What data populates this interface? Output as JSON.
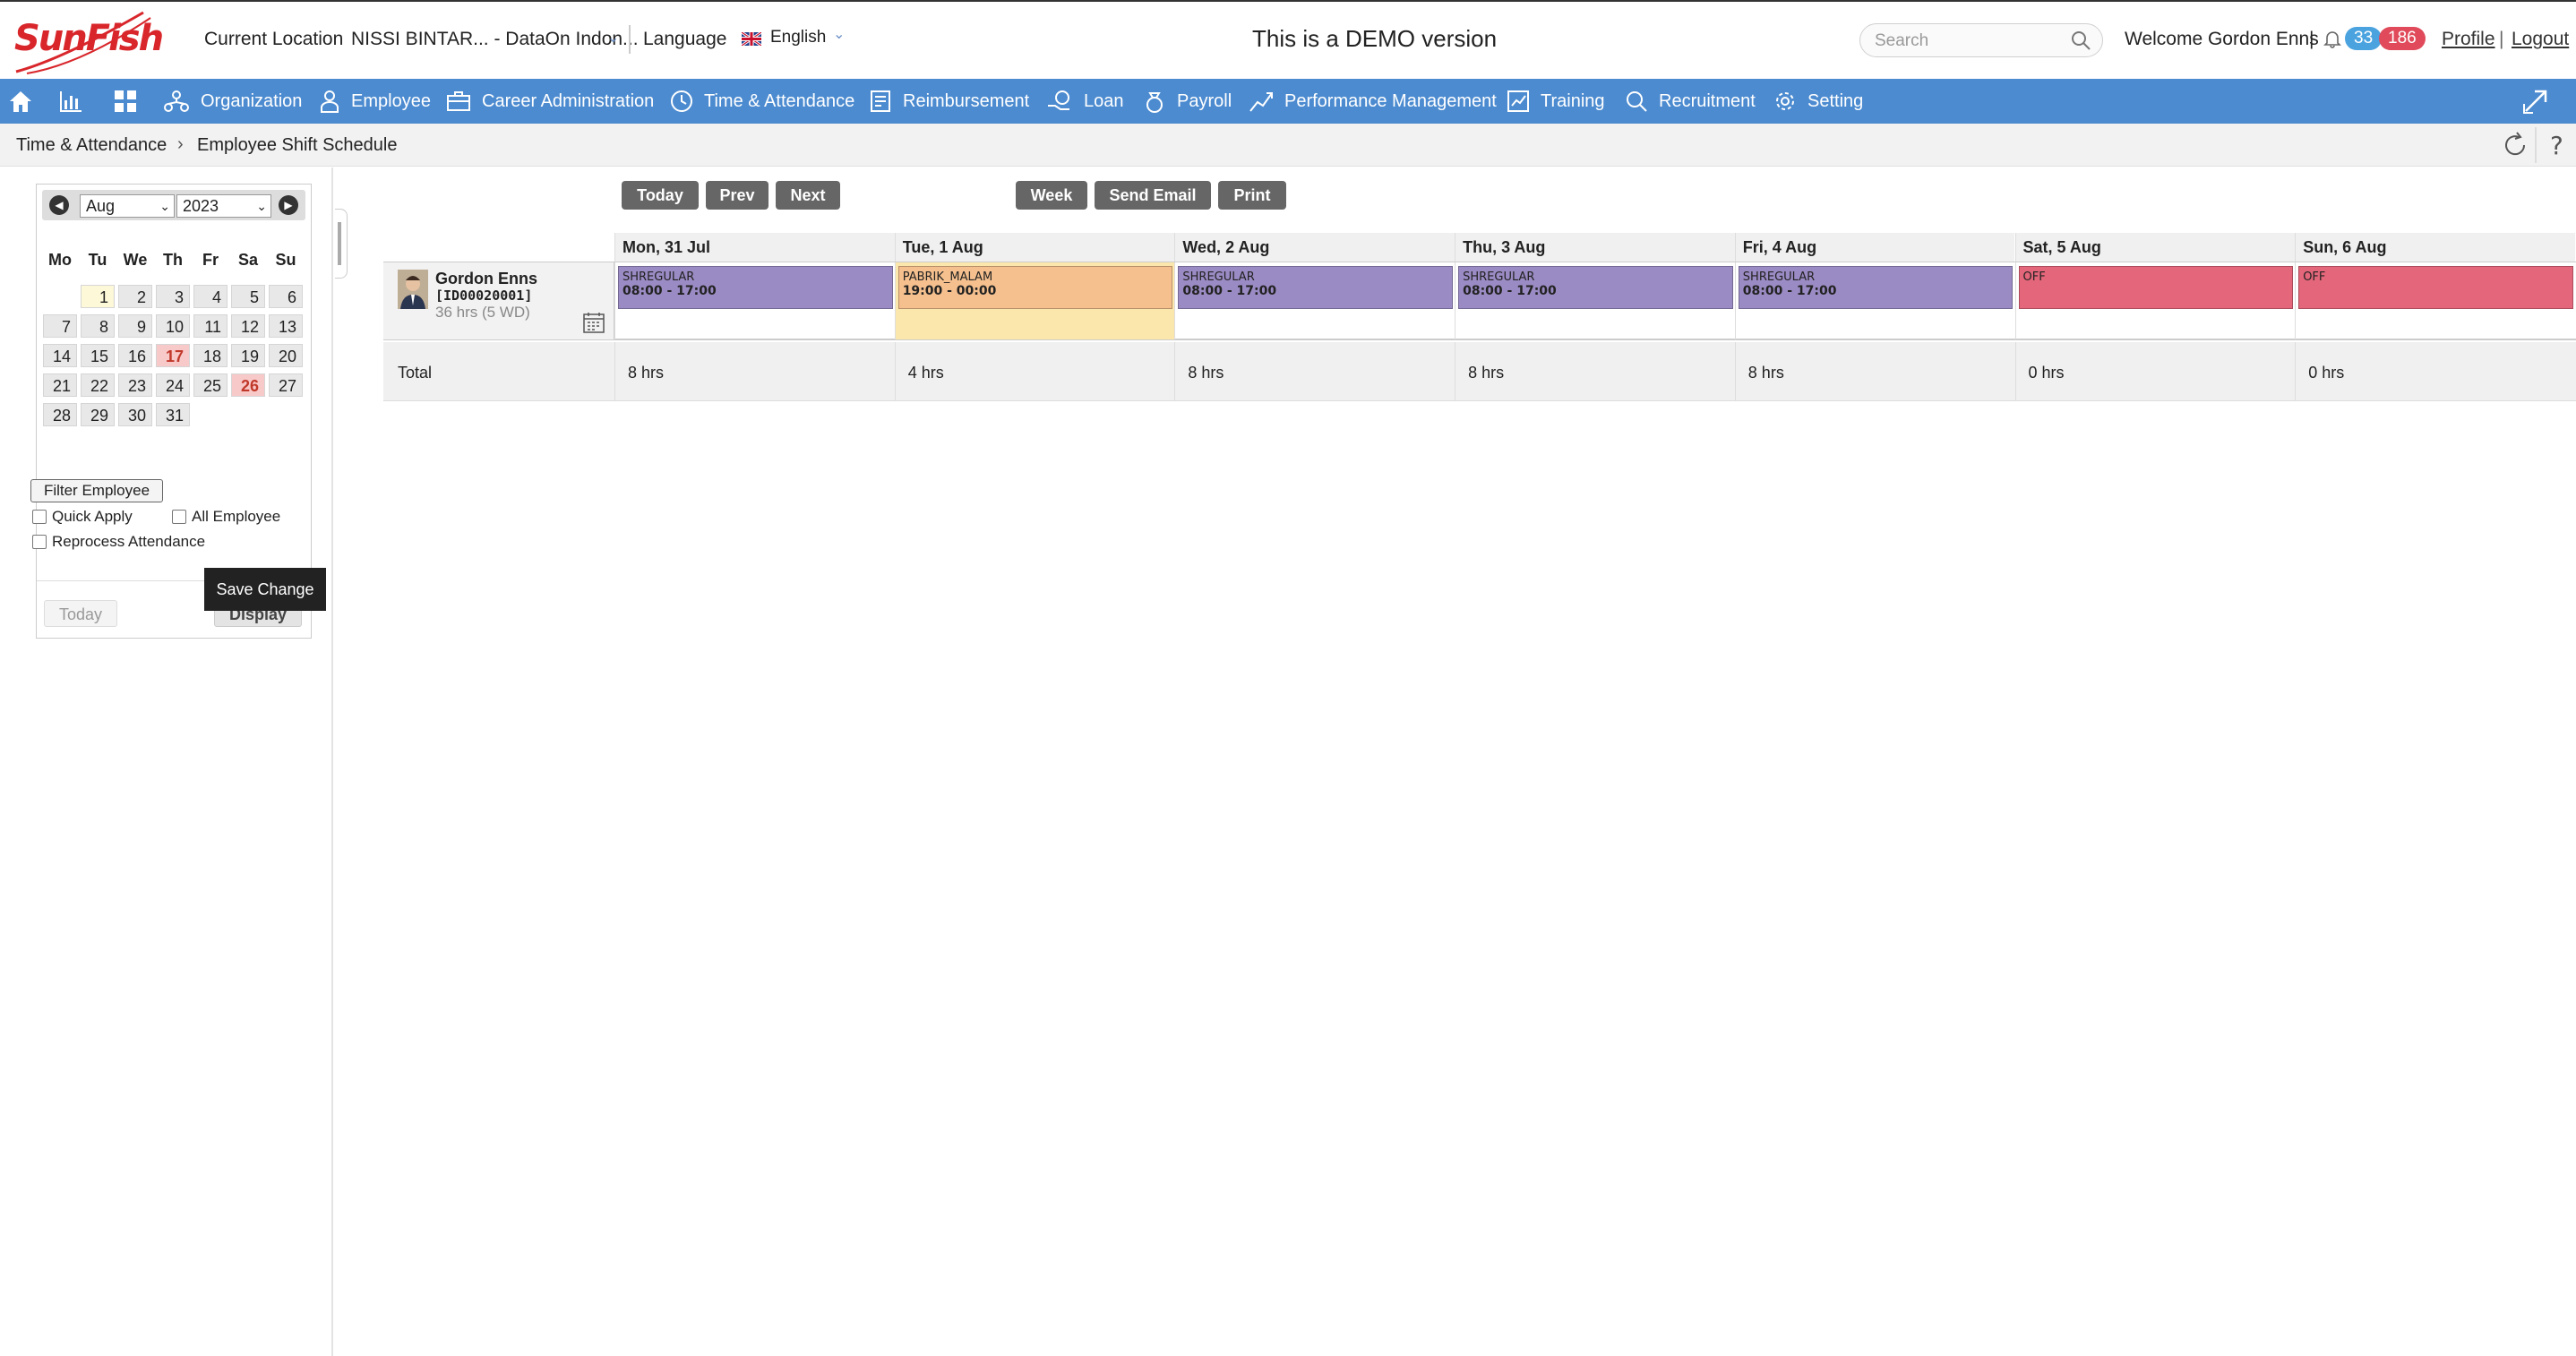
{
  "header": {
    "logo_text": "SunFish",
    "location_label": "Current Location",
    "location_value": "NISSI BINTAR... - DataOn Indon...",
    "language_label": "Language",
    "language_value": "English",
    "demo_text": "This is a DEMO version",
    "search_placeholder": "Search",
    "welcome_text": "Welcome Gordon Enns",
    "separator": "|",
    "notif_count_1": "33",
    "notif_count_2": "186",
    "profile_link": "Profile",
    "link_sep": "|",
    "logout_link": "Logout",
    "badge_colors": {
      "blue": "#4aa3df",
      "red": "#e04a5a"
    }
  },
  "nav": {
    "items": [
      {
        "label": "",
        "icon": "home-icon"
      },
      {
        "label": "",
        "icon": "dashboard-chart-icon"
      },
      {
        "label": "",
        "icon": "grid-apps-icon"
      },
      {
        "label": "Organization",
        "icon": "organization-icon"
      },
      {
        "label": "Employee",
        "icon": "employee-icon"
      },
      {
        "label": "Career Administration",
        "icon": "briefcase-icon"
      },
      {
        "label": "Time & Attendance",
        "icon": "clock-icon"
      },
      {
        "label": "Reimbursement",
        "icon": "reimbursement-icon"
      },
      {
        "label": "Loan",
        "icon": "loan-icon"
      },
      {
        "label": "Payroll",
        "icon": "payroll-icon"
      },
      {
        "label": "Performance Management",
        "icon": "performance-icon"
      },
      {
        "label": "Training",
        "icon": "training-icon"
      },
      {
        "label": "Recruitment",
        "icon": "recruitment-icon"
      },
      {
        "label": "Setting",
        "icon": "gear-icon"
      }
    ],
    "bar_color": "#4c8bd0"
  },
  "breadcrumb": {
    "module": "Time & Attendance",
    "sep": "›",
    "page": "Employee Shift Schedule"
  },
  "sidebar": {
    "calendar": {
      "month": "Aug",
      "year": "2023",
      "weekdays": [
        "Mo",
        "Tu",
        "We",
        "Th",
        "Fr",
        "Sa",
        "Su"
      ],
      "weeks": [
        [
          "",
          "1",
          "2",
          "3",
          "4",
          "5",
          "6"
        ],
        [
          "7",
          "8",
          "9",
          "10",
          "11",
          "12",
          "13"
        ],
        [
          "14",
          "15",
          "16",
          "17",
          "18",
          "19",
          "20"
        ],
        [
          "21",
          "22",
          "23",
          "24",
          "25",
          "26",
          "27"
        ],
        [
          "28",
          "29",
          "30",
          "31",
          "",
          "",
          ""
        ]
      ],
      "today_day": "1",
      "highlighted_days": [
        "17",
        "26"
      ],
      "today_button": "Today",
      "display_button": "Display"
    },
    "filter_button": "Filter Employee",
    "quick_apply_label": "Quick Apply",
    "all_employee_label": "All Employee",
    "reprocess_label": "Reprocess Attendance",
    "save_button": "Save Change"
  },
  "toolbar": {
    "today": "Today",
    "prev": "Prev",
    "next": "Next",
    "week": "Week",
    "send_email": "Send Email",
    "print": "Print"
  },
  "schedule": {
    "days": [
      "Mon, 31 Jul",
      "Tue, 1 Aug",
      "Wed, 2 Aug",
      "Thu, 3 Aug",
      "Fri, 4 Aug",
      "Sat, 5 Aug",
      "Sun, 6 Aug"
    ],
    "employee": {
      "name": "Gordon Enns",
      "id": "[ID00020001]",
      "hours": "36 hrs (5 WD)"
    },
    "shifts": [
      {
        "code": "SHREGULAR",
        "time": "08:00 - 17:00",
        "color": "#9b8bc4"
      },
      {
        "code": "PABRIK_MALAM",
        "time": "19:00 - 00:00",
        "color": "#f5c08e"
      },
      {
        "code": "SHREGULAR",
        "time": "08:00 - 17:00",
        "color": "#9b8bc4"
      },
      {
        "code": "SHREGULAR",
        "time": "08:00 - 17:00",
        "color": "#9b8bc4"
      },
      {
        "code": "SHREGULAR",
        "time": "08:00 - 17:00",
        "color": "#9b8bc4"
      },
      {
        "code": "OFF",
        "time": "",
        "color": "#e3667a"
      },
      {
        "code": "OFF",
        "time": "",
        "color": "#e3667a"
      }
    ],
    "total_label": "Total",
    "totals": [
      "8 hrs",
      "4 hrs",
      "8 hrs",
      "8 hrs",
      "8 hrs",
      "0 hrs",
      "0 hrs"
    ]
  }
}
